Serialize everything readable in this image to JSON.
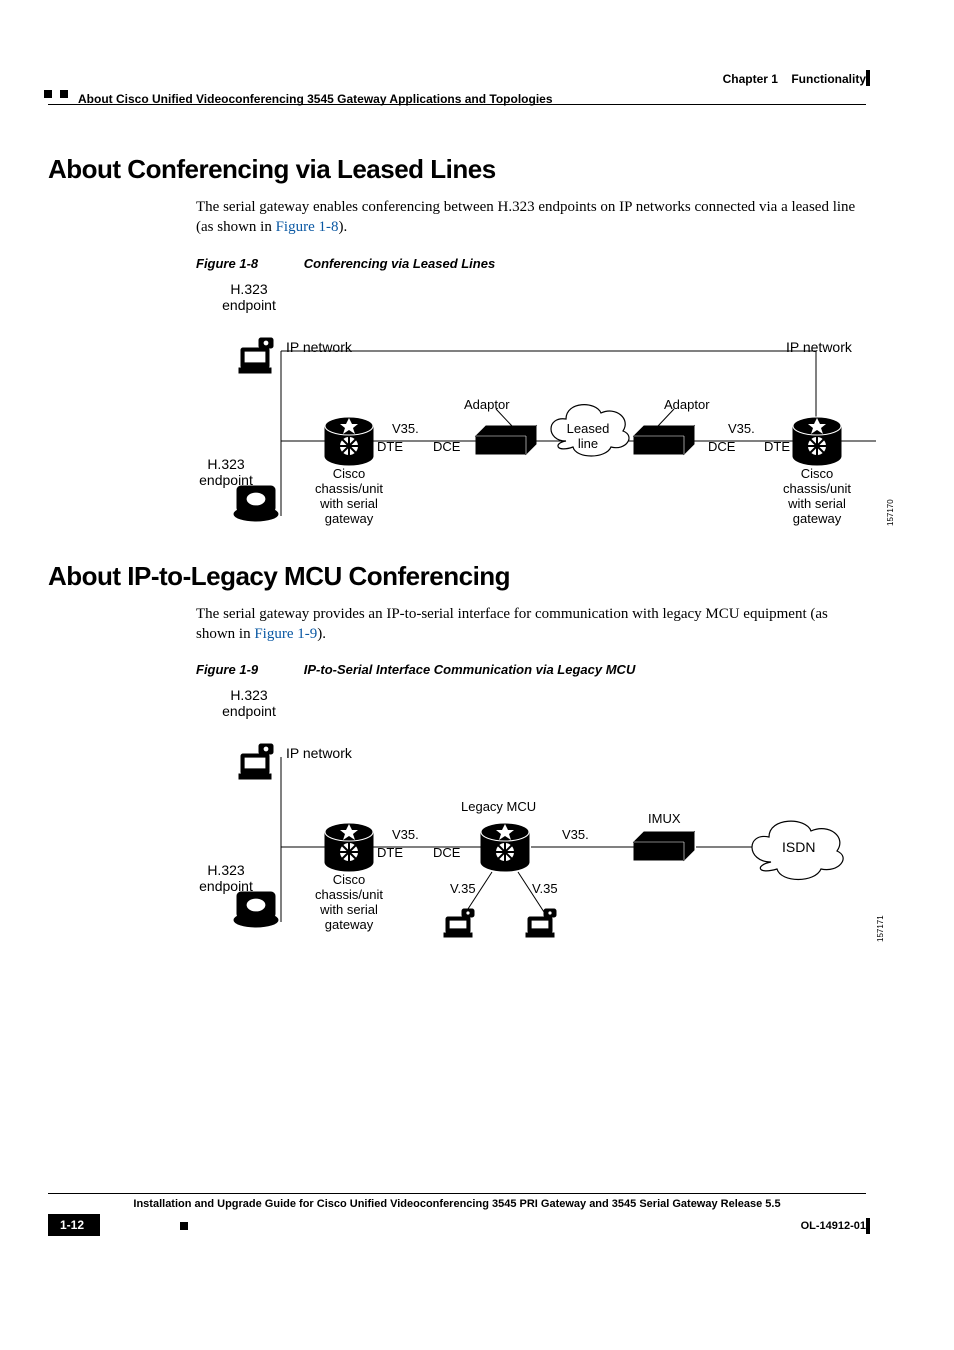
{
  "header": {
    "chapter": "Chapter 1",
    "section": "Functionality",
    "breadcrumb": "About Cisco Unified Videoconferencing 3545 Gateway Applications and Topologies"
  },
  "sec1": {
    "title": "About Conferencing via Leased Lines",
    "para_a": "The serial gateway enables conferencing between H.323 endpoints on IP networks connected via a leased line (as shown in ",
    "link": "Figure 1-8",
    "para_b": ").",
    "fig_num": "Figure 1-8",
    "fig_title": "Conferencing via Leased Lines"
  },
  "fig8": {
    "h323": "H.323",
    "endpoint": "endpoint",
    "ipnet": "IP network",
    "v35": "V35.",
    "dte": "DTE",
    "dce": "DCE",
    "adaptor": "Adaptor",
    "leased": "Leased",
    "line": "line",
    "cisco1": "Cisco",
    "cisco2": "chassis/unit",
    "cisco3": "with serial",
    "cisco4": "gateway",
    "imgnum": "157170"
  },
  "sec2": {
    "title": "About IP-to-Legacy MCU Conferencing",
    "para_a": "The serial gateway provides an IP-to-serial interface for communication with legacy MCU equipment (as shown in ",
    "link": "Figure 1-9",
    "para_b": ").",
    "fig_num": "Figure 1-9",
    "fig_title": "IP-to-Serial Interface Communication via Legacy MCU"
  },
  "fig9": {
    "h323": "H.323",
    "endpoint": "endpoint",
    "ipnet": "IP network",
    "v35": "V35.",
    "v35dot": "V.35",
    "dte": "DTE",
    "dce": "DCE",
    "legacy": "Legacy MCU",
    "imux": "IMUX",
    "isdn": "ISDN",
    "cisco1": "Cisco",
    "cisco2": "chassis/unit",
    "cisco3": "with serial",
    "cisco4": "gateway",
    "imgnum": "157171"
  },
  "footer": {
    "title": "Installation and Upgrade Guide for Cisco Unified Videoconferencing 3545 PRI Gateway and 3545 Serial Gateway Release 5.5",
    "page": "1-12",
    "doc": "OL-14912-01"
  }
}
